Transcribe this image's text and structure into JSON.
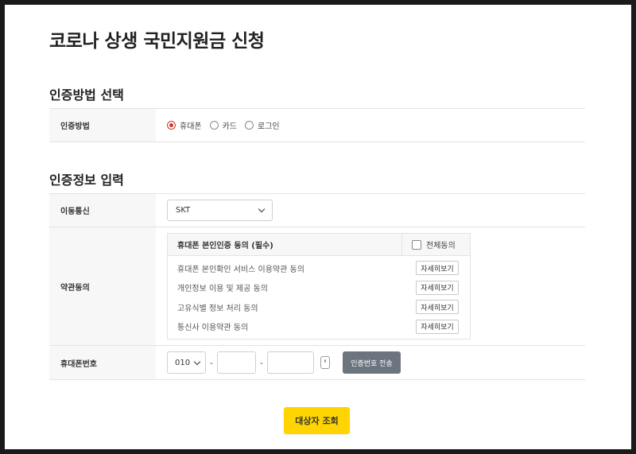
{
  "page": {
    "title": "코로나 상생 국민지원금 신청"
  },
  "auth_method": {
    "section_title": "인증방법 선택",
    "label": "인증방법",
    "options": [
      {
        "label": "휴대폰",
        "checked": true
      },
      {
        "label": "카드",
        "checked": false
      },
      {
        "label": "로그인",
        "checked": false
      }
    ]
  },
  "auth_info": {
    "section_title": "인증정보 입력",
    "carrier": {
      "label": "이동통신",
      "selected": "SKT"
    },
    "terms": {
      "label": "약관동의",
      "header": "휴대폰 본인인증 동의 (필수)",
      "agree_all": "전체동의",
      "items": [
        {
          "label": "휴대폰 본인확인 서비스 이용약관 동의",
          "button": "자세히보기"
        },
        {
          "label": "개인정보 이용 및 제공 동의",
          "button": "자세히보기"
        },
        {
          "label": "고유식별 정보 처리 동의",
          "button": "자세히보기"
        },
        {
          "label": "통신사 이용약관 동의",
          "button": "자세히보기"
        }
      ]
    },
    "phone": {
      "label": "휴대폰번호",
      "prefix": "010",
      "middle": "",
      "last": "",
      "send_button": "인증번호 전송"
    }
  },
  "submit_button": "대상자 조회",
  "colors": {
    "accent": "#ffd400",
    "radio": "#d9342b",
    "send_button": "#6c7480"
  }
}
